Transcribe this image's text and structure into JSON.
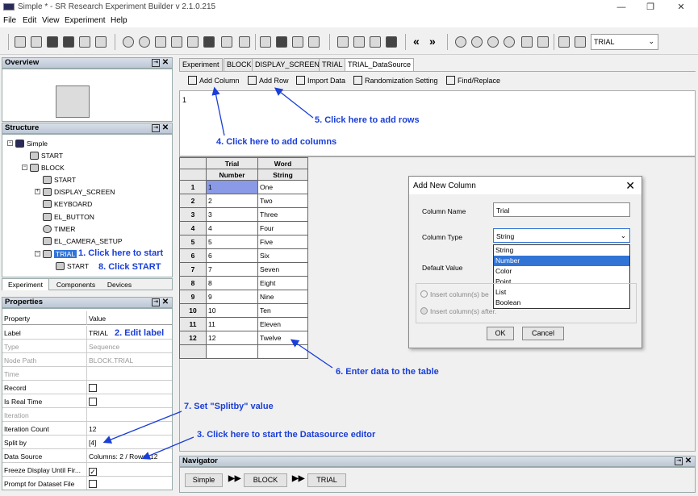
{
  "window": {
    "title": "Simple * - SR Research Experiment Builder v 2.1.0.215",
    "minimize": "—",
    "maximize": "❐",
    "close": "✕"
  },
  "menu": [
    "File",
    "Edit",
    "View",
    "Experiment",
    "Help"
  ],
  "toolbar": {
    "trial_select": "TRIAL",
    "arrow": "⌄",
    "nav_back": "«",
    "nav_fwd": "»"
  },
  "overview": {
    "title": "Overview"
  },
  "structure": {
    "title": "Structure",
    "tree": [
      {
        "label": "Simple",
        "icon": "experiment-icon"
      },
      {
        "label": "START",
        "icon": "start-icon"
      },
      {
        "label": "BLOCK",
        "icon": "sequence-icon"
      },
      {
        "label": "START",
        "icon": "start-icon"
      },
      {
        "label": "DISPLAY_SCREEN",
        "icon": "display-icon"
      },
      {
        "label": "KEYBOARD",
        "icon": "keyboard-icon"
      },
      {
        "label": "EL_BUTTON",
        "icon": "button-icon"
      },
      {
        "label": "TIMER",
        "icon": "timer-icon"
      },
      {
        "label": "EL_CAMERA_SETUP",
        "icon": "camera-icon"
      },
      {
        "label": "TRIAL",
        "icon": "sequence-icon"
      },
      {
        "label": "START",
        "icon": "start-icon"
      }
    ],
    "tabs": [
      "Experiment",
      "Components",
      "Devices"
    ]
  },
  "properties": {
    "title": "Properties",
    "col_property": "Property",
    "col_value": "Value",
    "rows": [
      {
        "key": "Label",
        "value": "TRIAL"
      },
      {
        "key": "Type",
        "value": "Sequence"
      },
      {
        "key": "Node Path",
        "value": "BLOCK.TRIAL"
      },
      {
        "key": "Time",
        "value": ""
      },
      {
        "key": "Record",
        "value": ""
      },
      {
        "key": "Is Real Time",
        "value": ""
      },
      {
        "key": "Iteration",
        "value": ""
      },
      {
        "key": "Iteration Count",
        "value": "12"
      },
      {
        "key": "Split by",
        "value": "[4]"
      },
      {
        "key": "Data Source",
        "value": "Columns: 2 / Rows: 12"
      },
      {
        "key": "Freeze Display Until Fir...",
        "value": "✓"
      },
      {
        "key": "Prompt for Dataset File",
        "value": ""
      }
    ]
  },
  "editor_tabs": [
    "Experiment",
    "BLOCK",
    "DISPLAY_SCREEN",
    "TRIAL",
    "TRIAL_DataSource"
  ],
  "datasource_toolbar": [
    "Add Column",
    "Add Row",
    "Import Data",
    "Randomization Setting",
    "Find/Replace"
  ],
  "script_line": "1",
  "grid": {
    "columns": [
      {
        "name": "Trial",
        "type": "Number"
      },
      {
        "name": "Word",
        "type": "String"
      }
    ],
    "rows": [
      [
        "1",
        "1",
        "One"
      ],
      [
        "2",
        "2",
        "Two"
      ],
      [
        "3",
        "3",
        "Three"
      ],
      [
        "4",
        "4",
        "Four"
      ],
      [
        "5",
        "5",
        "Five"
      ],
      [
        "6",
        "6",
        "Six"
      ],
      [
        "7",
        "7",
        "Seven"
      ],
      [
        "8",
        "8",
        "Eight"
      ],
      [
        "9",
        "9",
        "Nine"
      ],
      [
        "10",
        "10",
        "Ten"
      ],
      [
        "11",
        "11",
        "Eleven"
      ],
      [
        "12",
        "12",
        "Twelve"
      ]
    ]
  },
  "dialog": {
    "title": "Add New Column",
    "column_name_label": "Column Name",
    "column_name_value": "Trial",
    "column_type_label": "Column Type",
    "column_type_value": "String",
    "type_options": [
      "String",
      "Number",
      "Color",
      "Point",
      "List",
      "Boolean"
    ],
    "default_value_label": "Default Value",
    "insert_before": "Insert column(s) be",
    "insert_after": "Insert column(s) after.",
    "ok": "OK",
    "cancel": "Cancel"
  },
  "navigator": {
    "title": "Navigator",
    "crumbs": [
      "Simple",
      "BLOCK",
      "TRIAL"
    ],
    "sep": "▶▶"
  },
  "annotations": [
    "1. Click here to start",
    "2. Edit label",
    "3. Click here to start the Datasource editor",
    "4. Click here to add columns",
    "5. Click here to add rows",
    "6. Enter data to the table",
    "7. Set \"Splitby\" value",
    "8. Click START"
  ],
  "colors": {
    "annotation": "#1a3ed8",
    "selection": "#3174d6",
    "grid_highlight": "#8a9ae6"
  }
}
